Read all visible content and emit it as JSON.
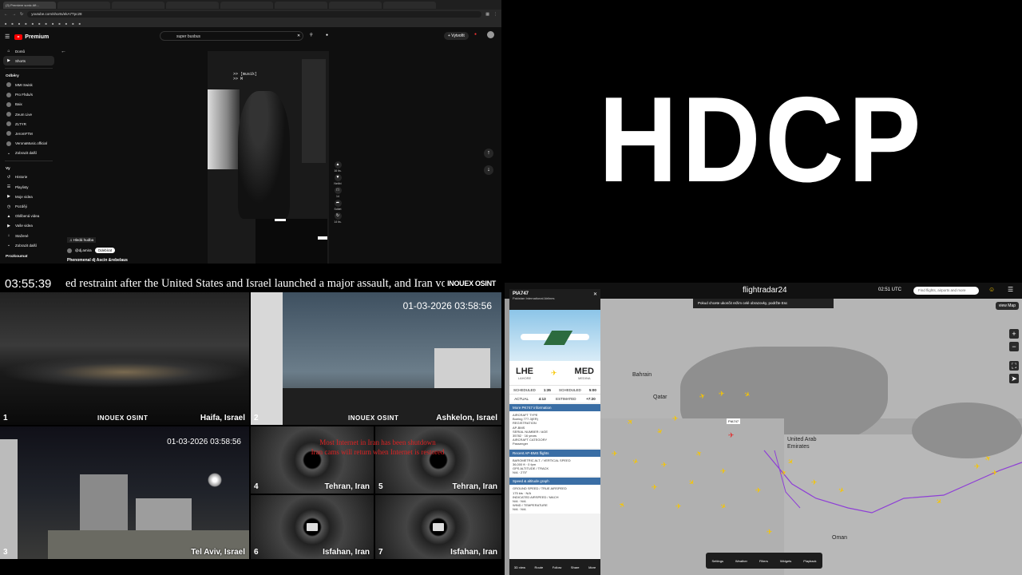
{
  "browser": {
    "tabs": [
      "(3) Premiere sonic Aft…",
      "",
      "",
      "",
      "",
      "",
      "",
      "",
      ""
    ],
    "url": "youtube.com/shorts/ekA7Tpc28",
    "bookmarks": [
      "",
      "",
      "",
      "",
      "",
      "",
      "",
      "",
      "",
      "",
      "",
      "",
      "",
      ""
    ]
  },
  "youtube": {
    "logo": "Premium",
    "search_value": "super busbus",
    "create_label": "+ Vytvořit",
    "sidebar_top": [
      {
        "label": "Domů",
        "icon": "home-icon"
      },
      {
        "label": "Shorts",
        "icon": "shorts-icon"
      }
    ],
    "subs_header": "Odběry",
    "subs": [
      "MMI Swisk",
      "Pro Fhdu/s",
      "Baix",
      "Zeum Live",
      "ZLTYR",
      "JeromFTM",
      "VeronaMusic.official",
      "Zobrazit další"
    ],
    "you_header": "Vy",
    "you_items": [
      "Historie",
      "Playlisty",
      "Moje videa",
      "Později",
      "Oblíbená videa",
      "Vaše videa",
      "Stažené",
      "Zobrazit další"
    ],
    "footer_header": "Prozkoumat",
    "short_overlay": ">> [musik]\n>> M",
    "short_channel": "@dj.amira",
    "subscribe_label": "Odebírat",
    "short_title": "Phenomenal dj Ascin &rebelaus",
    "music_chip": "Hledá hudba",
    "actions": [
      "16 tis.",
      "Nelíbí",
      "14",
      "Sdílet",
      "14 tis."
    ]
  },
  "hdcp": {
    "text": "HDCP"
  },
  "cams": {
    "clock": "03:55:39",
    "ticker": "ed restraint after the United States and Israel launched a major assault, and Iran vowe",
    "ticker_logo": "INOUEX OSINT",
    "feeds": [
      {
        "num": "1",
        "label": "Haifa, Israel",
        "timestamp": ""
      },
      {
        "num": "2",
        "label": "Ashkelon, Israel",
        "timestamp": "01-03-2026 03:58:56"
      },
      {
        "num": "3",
        "label": "Tel Aviv, Israel",
        "timestamp": "01-03-2026 03:58:56"
      },
      {
        "num": "4",
        "label": "Tehran, Iran",
        "timestamp": ""
      },
      {
        "num": "5",
        "label": "Tehran, Iran",
        "timestamp": ""
      },
      {
        "num": "6",
        "label": "Isfahan, Iran",
        "timestamp": ""
      },
      {
        "num": "7",
        "label": "Isfahan, Iran",
        "timestamp": ""
      }
    ],
    "red_notice": "Most Internet in Iran has been shutdown\nIran cams will return when Internet is restored",
    "logo": "INOUEX OSINT"
  },
  "flightradar": {
    "brand": "flightradar24",
    "time": "02:51 UTC",
    "search_placeholder": "Find flights, airports and more",
    "tip": "Pokud chcete ukončit režim celé obrazovky, podržte  Esc",
    "flight": "PIA747",
    "airline": "Pakistan International Airlines",
    "from_code": "LHE",
    "from_city": "LAHORE",
    "to_code": "MED",
    "to_city": "MEDINA",
    "times": [
      [
        "SCHEDULED",
        "1:35",
        "SCHEDULED",
        "5:00"
      ],
      [
        "ACTUAL",
        "4:13",
        "ESTIMATED",
        "+7:20"
      ]
    ],
    "sec_info": "More PK747 information",
    "aircraft_type": "Boeing 777-3(ER)",
    "registration": "AP-BMS",
    "serial": "35782",
    "age": "16 years",
    "category": "Passenger",
    "sec_recent": "Recent AP-BMS flights",
    "baro_alt": "36,000 ft",
    "vspeed": "0 fpm",
    "gps_alt": "N/A",
    "track": "275°",
    "sec_speed": "Speed & altitude graph",
    "ground_speed": "175 kts",
    "true_airspeed": "N/A",
    "indicated_airspeed": "N/A",
    "mach": "N/A",
    "wind": "N/A",
    "temperature": "N/A",
    "panel_footer": [
      "3D view",
      "Route",
      "Follow",
      "Share",
      "More"
    ],
    "bottom_bar": [
      "Settings",
      "Weather",
      "Filters",
      "Widgets",
      "Playback"
    ],
    "map_style": "Map",
    "labels": {
      "bahrain": "Bahrain",
      "qatar": "Qatar",
      "uae": "United Arab\nEmirates",
      "oman": "Oman",
      "callout": "PIA747"
    }
  }
}
